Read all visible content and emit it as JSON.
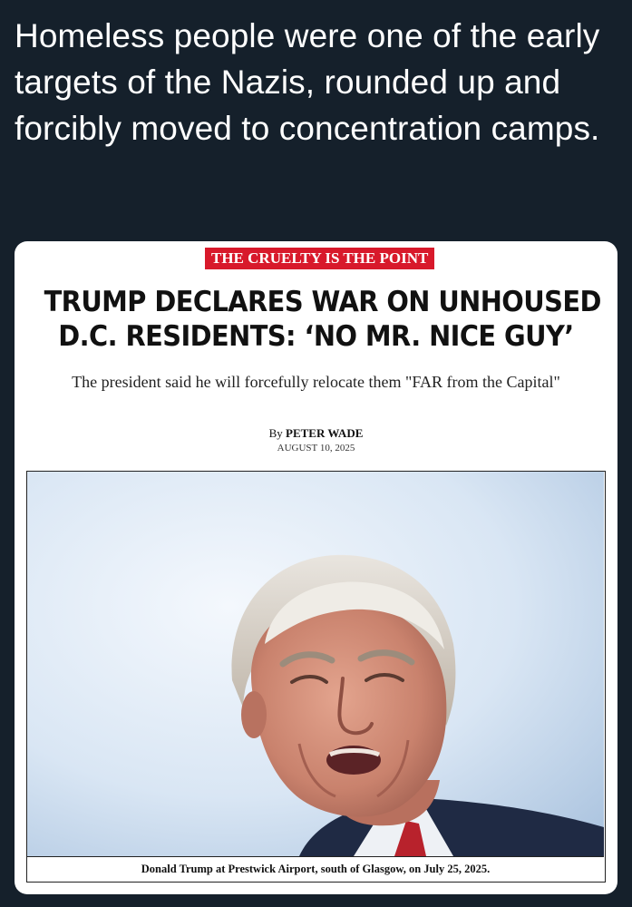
{
  "tweet": {
    "text": "Homeless people were one of the early targets of the Nazis, rounded up and forcibly moved to concentration camps."
  },
  "article": {
    "kicker": "THE CRUELTY IS THE POINT",
    "headline_line1": "TRUMP DECLARES WAR ON UNHOUSED",
    "headline_line2": "D.C. RESIDENTS: ‘NO MR. NICE GUY’",
    "subheadline": "The president said he will forcefully relocate them \"FAR from the Capital\"",
    "byline_prefix": "By ",
    "byline_author": "PETER WADE",
    "date": "AUGUST 10, 2025",
    "photo_caption": "Donald Trump at Prestwick Airport, south of Glasgow, on July 25, 2025."
  },
  "colors": {
    "page_background": "#15202b",
    "tweet_text": "#ffffff",
    "card_background": "#ffffff",
    "kicker_background": "#d8192b",
    "headline": "#111111"
  }
}
